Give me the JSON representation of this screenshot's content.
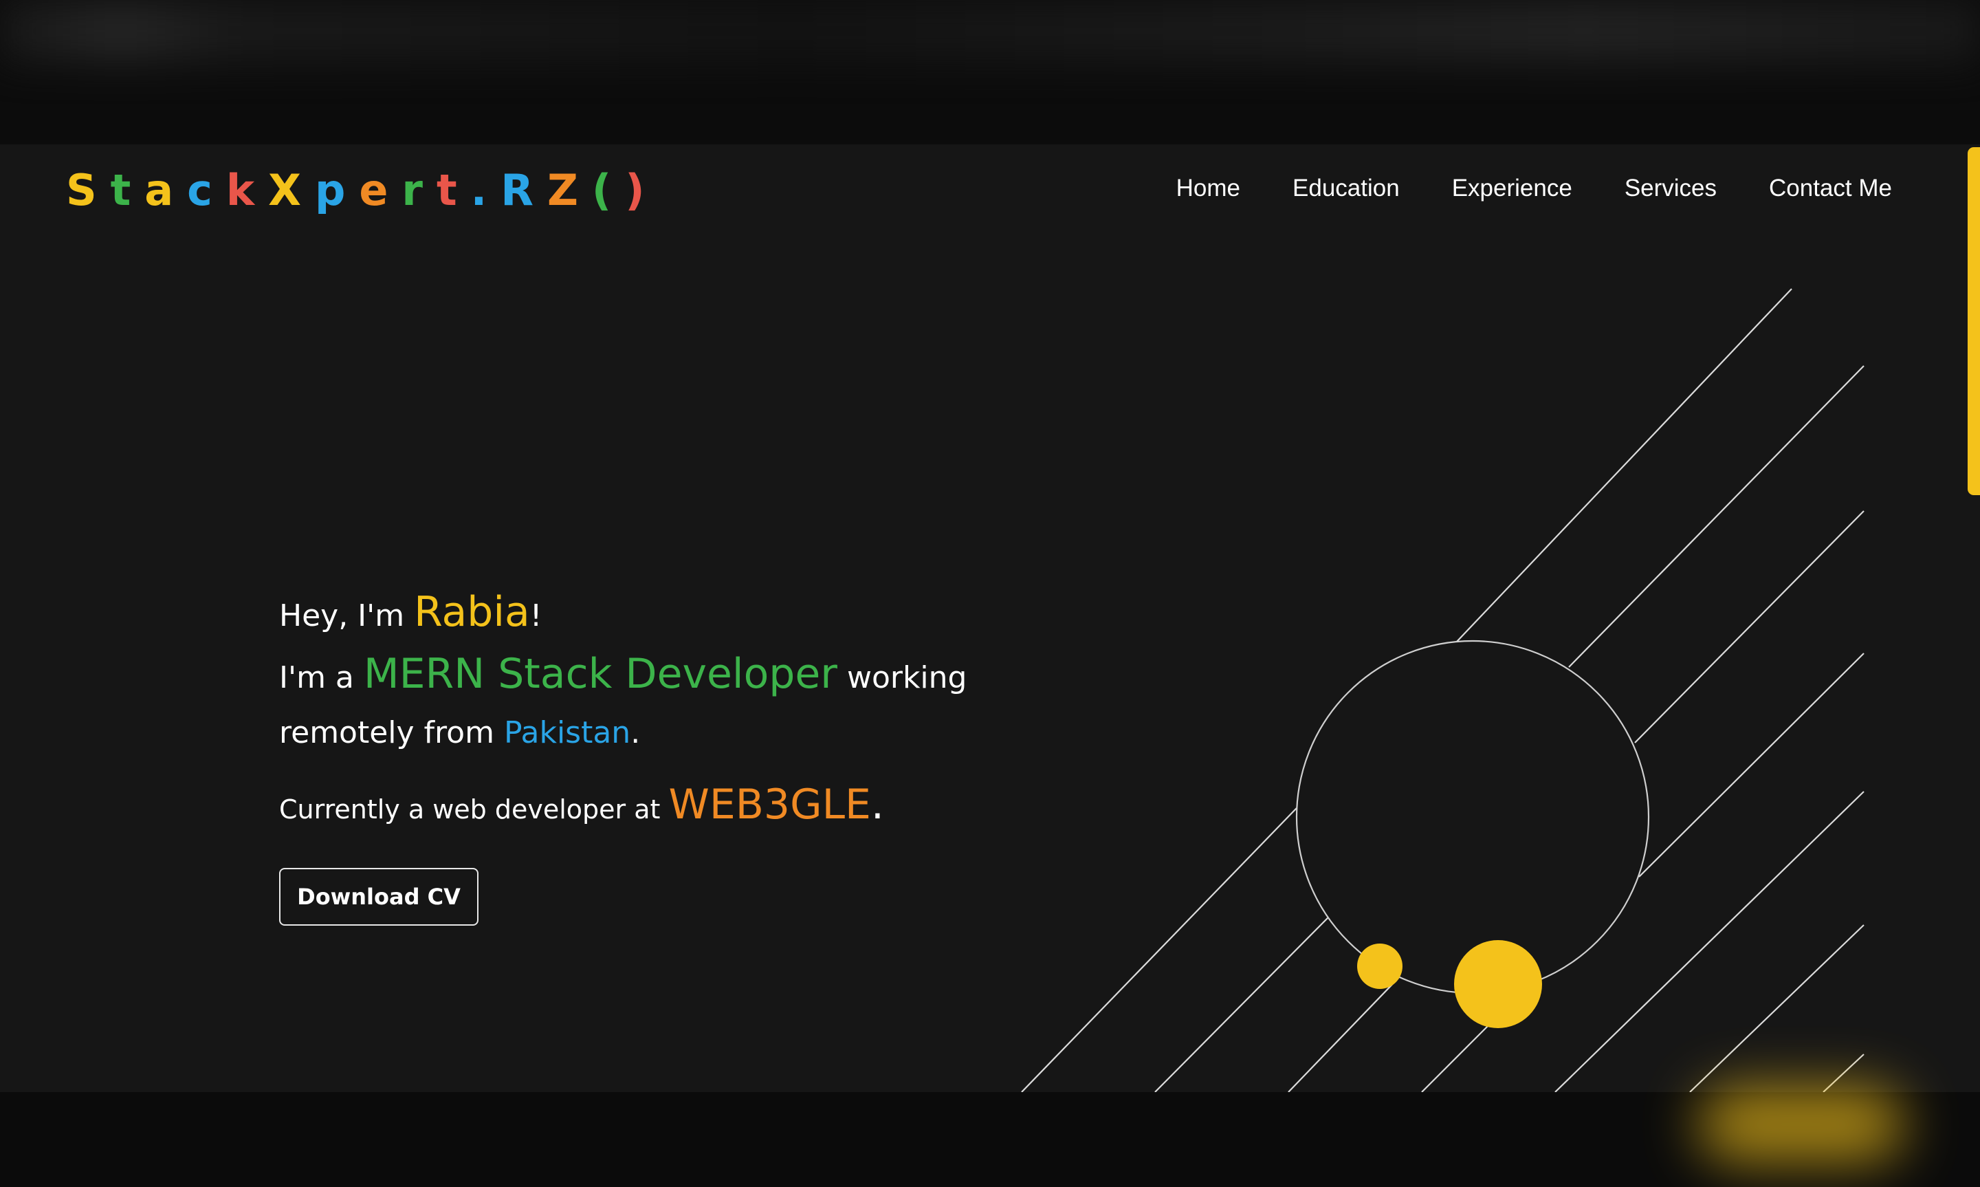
{
  "logo": {
    "letters": [
      "S",
      "t",
      "a",
      "c",
      "k",
      "X",
      "p",
      "e",
      "r",
      "t",
      ".",
      "R",
      "Z",
      "(",
      ")"
    ],
    "colors": [
      "#f4c21b",
      "#3cb34a",
      "#f4c21b",
      "#2aa4e6",
      "#e9564a",
      "#f4c21b",
      "#2aa4e6",
      "#f08a24",
      "#3cb34a",
      "#e9564a",
      "#2aa4e6",
      "#2aa4e6",
      "#f08a24",
      "#3cb34a",
      "#e9564a"
    ]
  },
  "nav": {
    "items": [
      "Home",
      "Education",
      "Experience",
      "Services",
      "Contact Me"
    ]
  },
  "hero": {
    "greeting_prefix": "Hey, I'm ",
    "name": "Rabia",
    "greeting_suffix": "!",
    "role_prefix": "I'm a ",
    "role": "MERN Stack Developer",
    "role_suffix": " working",
    "location_prefix": "remotely from ",
    "location": "Pakistan",
    "location_suffix": ".",
    "current_prefix": "Currently a web developer at ",
    "company": "WEB3GLE",
    "current_suffix": "."
  },
  "cta": {
    "download_label": "Download CV"
  },
  "colors": {
    "accent_yellow": "#f4c21b",
    "accent_green": "#3cb34a",
    "accent_blue": "#2aa4e6",
    "accent_orange": "#f08a24",
    "page_background": "#161616"
  }
}
